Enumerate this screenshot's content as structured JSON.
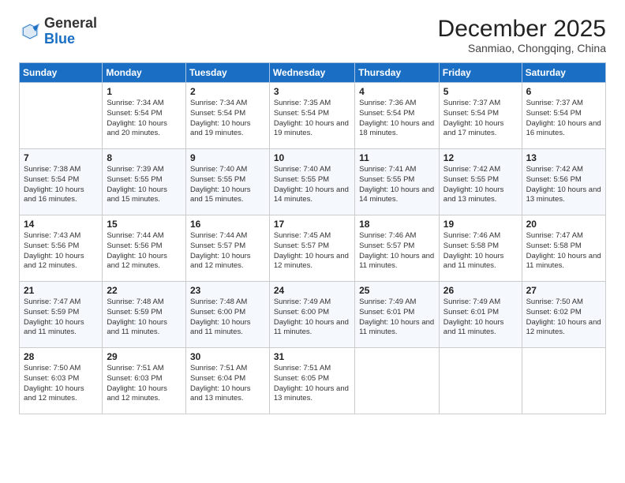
{
  "logo": {
    "general": "General",
    "blue": "Blue"
  },
  "title": "December 2025",
  "subtitle": "Sanmiao, Chongqing, China",
  "header_days": [
    "Sunday",
    "Monday",
    "Tuesday",
    "Wednesday",
    "Thursday",
    "Friday",
    "Saturday"
  ],
  "weeks": [
    [
      {
        "day": "",
        "info": ""
      },
      {
        "day": "1",
        "info": "Sunrise: 7:34 AM\nSunset: 5:54 PM\nDaylight: 10 hours and 20 minutes."
      },
      {
        "day": "2",
        "info": "Sunrise: 7:34 AM\nSunset: 5:54 PM\nDaylight: 10 hours and 19 minutes."
      },
      {
        "day": "3",
        "info": "Sunrise: 7:35 AM\nSunset: 5:54 PM\nDaylight: 10 hours and 19 minutes."
      },
      {
        "day": "4",
        "info": "Sunrise: 7:36 AM\nSunset: 5:54 PM\nDaylight: 10 hours and 18 minutes."
      },
      {
        "day": "5",
        "info": "Sunrise: 7:37 AM\nSunset: 5:54 PM\nDaylight: 10 hours and 17 minutes."
      },
      {
        "day": "6",
        "info": "Sunrise: 7:37 AM\nSunset: 5:54 PM\nDaylight: 10 hours and 16 minutes."
      }
    ],
    [
      {
        "day": "7",
        "info": "Sunrise: 7:38 AM\nSunset: 5:54 PM\nDaylight: 10 hours and 16 minutes."
      },
      {
        "day": "8",
        "info": "Sunrise: 7:39 AM\nSunset: 5:55 PM\nDaylight: 10 hours and 15 minutes."
      },
      {
        "day": "9",
        "info": "Sunrise: 7:40 AM\nSunset: 5:55 PM\nDaylight: 10 hours and 15 minutes."
      },
      {
        "day": "10",
        "info": "Sunrise: 7:40 AM\nSunset: 5:55 PM\nDaylight: 10 hours and 14 minutes."
      },
      {
        "day": "11",
        "info": "Sunrise: 7:41 AM\nSunset: 5:55 PM\nDaylight: 10 hours and 14 minutes."
      },
      {
        "day": "12",
        "info": "Sunrise: 7:42 AM\nSunset: 5:55 PM\nDaylight: 10 hours and 13 minutes."
      },
      {
        "day": "13",
        "info": "Sunrise: 7:42 AM\nSunset: 5:56 PM\nDaylight: 10 hours and 13 minutes."
      }
    ],
    [
      {
        "day": "14",
        "info": "Sunrise: 7:43 AM\nSunset: 5:56 PM\nDaylight: 10 hours and 12 minutes."
      },
      {
        "day": "15",
        "info": "Sunrise: 7:44 AM\nSunset: 5:56 PM\nDaylight: 10 hours and 12 minutes."
      },
      {
        "day": "16",
        "info": "Sunrise: 7:44 AM\nSunset: 5:57 PM\nDaylight: 10 hours and 12 minutes."
      },
      {
        "day": "17",
        "info": "Sunrise: 7:45 AM\nSunset: 5:57 PM\nDaylight: 10 hours and 12 minutes."
      },
      {
        "day": "18",
        "info": "Sunrise: 7:46 AM\nSunset: 5:57 PM\nDaylight: 10 hours and 11 minutes."
      },
      {
        "day": "19",
        "info": "Sunrise: 7:46 AM\nSunset: 5:58 PM\nDaylight: 10 hours and 11 minutes."
      },
      {
        "day": "20",
        "info": "Sunrise: 7:47 AM\nSunset: 5:58 PM\nDaylight: 10 hours and 11 minutes."
      }
    ],
    [
      {
        "day": "21",
        "info": "Sunrise: 7:47 AM\nSunset: 5:59 PM\nDaylight: 10 hours and 11 minutes."
      },
      {
        "day": "22",
        "info": "Sunrise: 7:48 AM\nSunset: 5:59 PM\nDaylight: 10 hours and 11 minutes."
      },
      {
        "day": "23",
        "info": "Sunrise: 7:48 AM\nSunset: 6:00 PM\nDaylight: 10 hours and 11 minutes."
      },
      {
        "day": "24",
        "info": "Sunrise: 7:49 AM\nSunset: 6:00 PM\nDaylight: 10 hours and 11 minutes."
      },
      {
        "day": "25",
        "info": "Sunrise: 7:49 AM\nSunset: 6:01 PM\nDaylight: 10 hours and 11 minutes."
      },
      {
        "day": "26",
        "info": "Sunrise: 7:49 AM\nSunset: 6:01 PM\nDaylight: 10 hours and 11 minutes."
      },
      {
        "day": "27",
        "info": "Sunrise: 7:50 AM\nSunset: 6:02 PM\nDaylight: 10 hours and 12 minutes."
      }
    ],
    [
      {
        "day": "28",
        "info": "Sunrise: 7:50 AM\nSunset: 6:03 PM\nDaylight: 10 hours and 12 minutes."
      },
      {
        "day": "29",
        "info": "Sunrise: 7:51 AM\nSunset: 6:03 PM\nDaylight: 10 hours and 12 minutes."
      },
      {
        "day": "30",
        "info": "Sunrise: 7:51 AM\nSunset: 6:04 PM\nDaylight: 10 hours and 13 minutes."
      },
      {
        "day": "31",
        "info": "Sunrise: 7:51 AM\nSunset: 6:05 PM\nDaylight: 10 hours and 13 minutes."
      },
      {
        "day": "",
        "info": ""
      },
      {
        "day": "",
        "info": ""
      },
      {
        "day": "",
        "info": ""
      }
    ]
  ]
}
